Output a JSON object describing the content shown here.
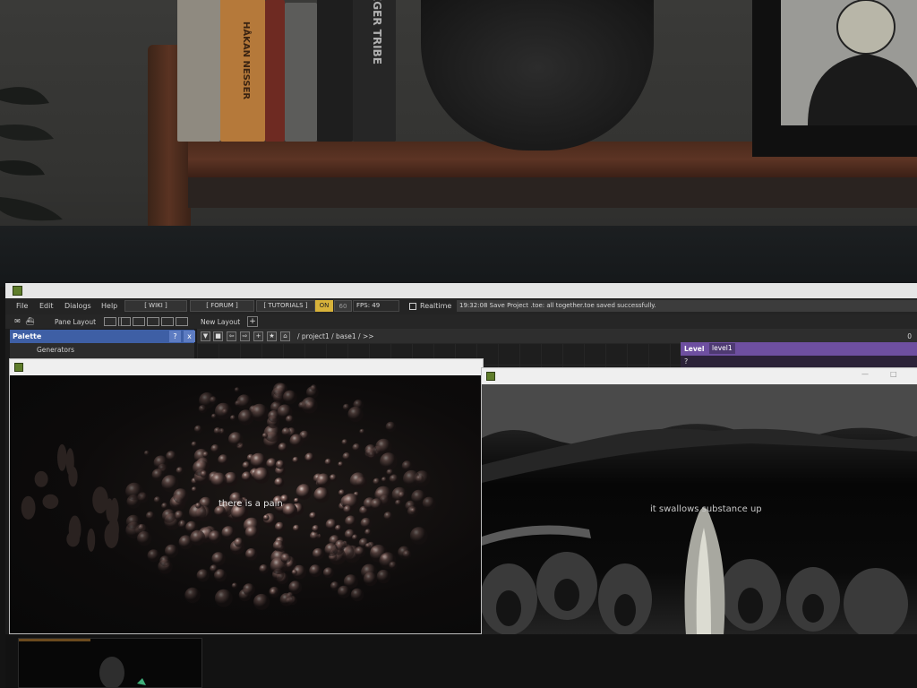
{
  "book_spines": [
    "HÅKAN NESSER",
    "EGER TRIBE"
  ],
  "app": {
    "menu": [
      "File",
      "Edit",
      "Dialogs",
      "Help"
    ],
    "links": [
      "[ WIKI ]",
      "[ FORUM ]",
      "[ TUTORIALS ]"
    ],
    "fps_toggle": "ON",
    "fps_cap": "60",
    "fps_readout": "FPS:  49",
    "realtime_label": "Realtime",
    "status_message": "19:32:08 Save Project .toe: all together.toe saved successfully."
  },
  "toolbar": {
    "pane_layout_label": "Pane Layout",
    "new_layout_label": "New Layout",
    "plus": "+"
  },
  "palette": {
    "title": "Palette",
    "help_btn": "?",
    "close_btn": "x",
    "first_item": "Generators"
  },
  "network": {
    "path": "/ project1 / base1 / >>",
    "counter": "0"
  },
  "level": {
    "label": "Level",
    "value": "level1",
    "help_glyph": "?"
  },
  "viewers": {
    "left_caption": "there is a pain",
    "right_caption": "it swallows substance up"
  },
  "colors": {
    "palette_blue": "#3e5fa5",
    "level_purple": "#6e4fa0",
    "fps_on_yellow": "#d7b23a"
  }
}
